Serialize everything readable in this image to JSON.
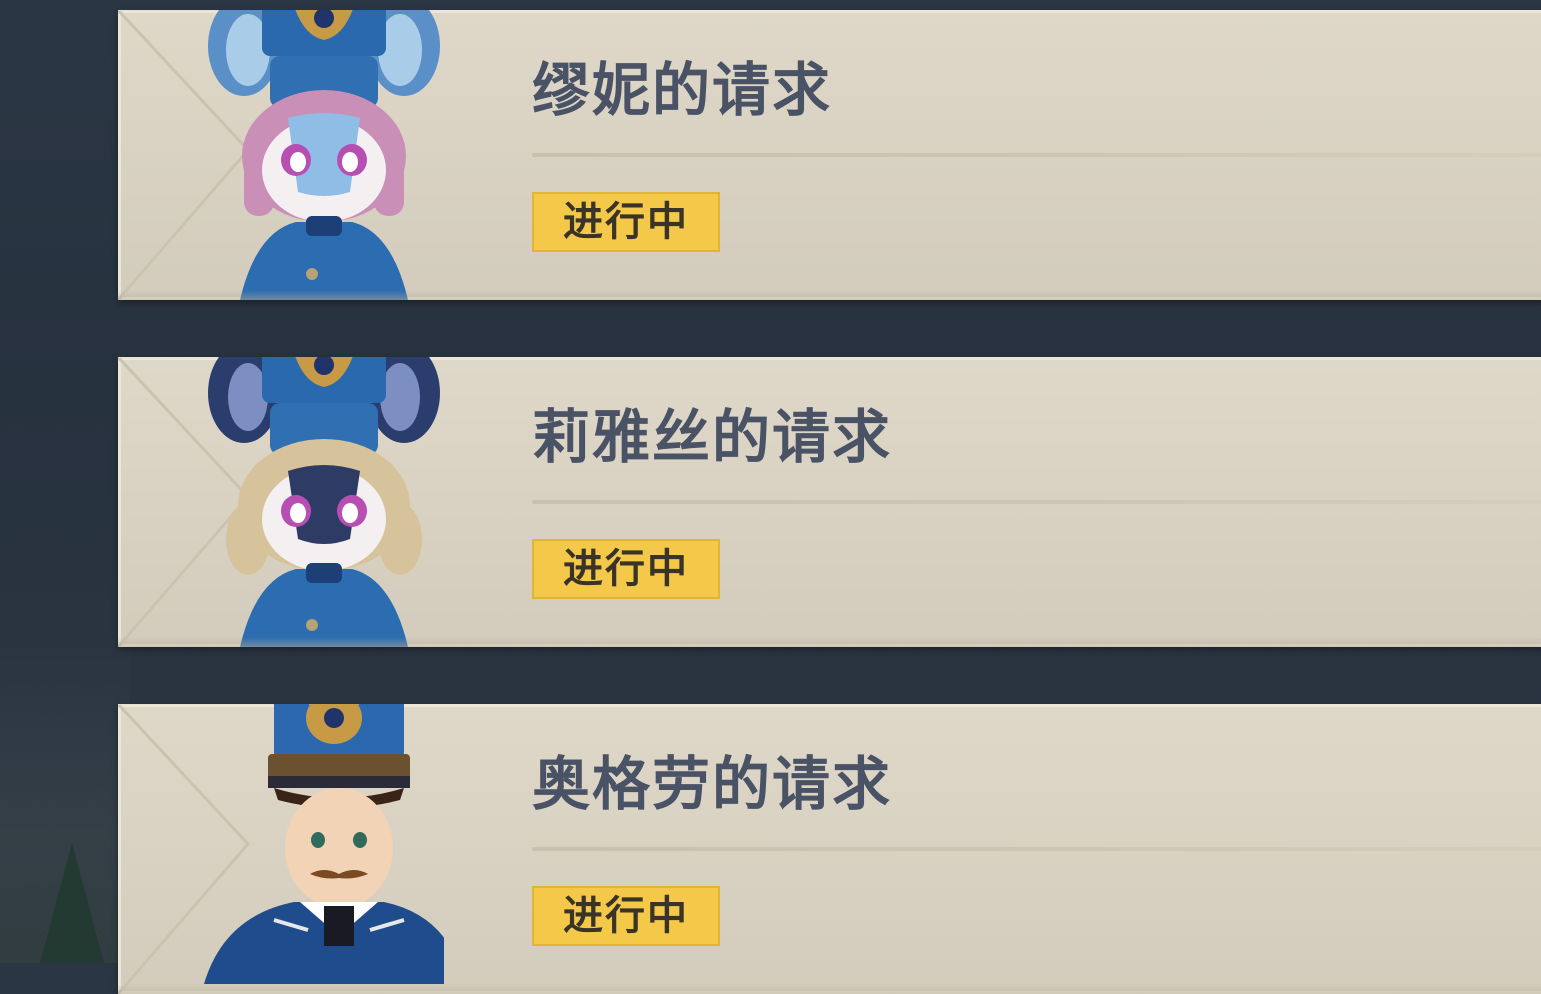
{
  "quests": [
    {
      "title": "缪妮的请求",
      "status": "进行中",
      "avatar_icon": "muni-portrait-icon"
    },
    {
      "title": "莉雅丝的请求",
      "status": "进行中",
      "avatar_icon": "liyasi-portrait-icon"
    },
    {
      "title": "奥格劳的请求",
      "status": "进行中",
      "avatar_icon": "ogrou-portrait-icon"
    }
  ],
  "colors": {
    "card_bg": "#dcd5c6",
    "title_text": "#4a5366",
    "status_badge": "#f4c94a",
    "page_bg": "#2b3644"
  }
}
